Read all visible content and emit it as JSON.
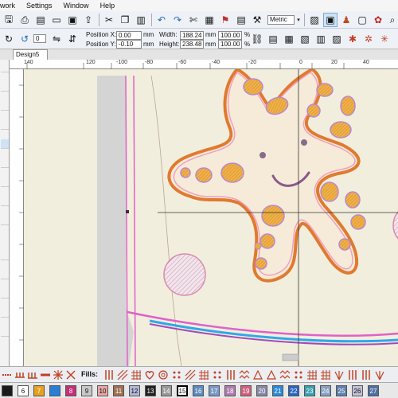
{
  "menu": [
    "work",
    "Settings",
    "Window",
    "Help"
  ],
  "toolbar": {
    "unit": "Metric",
    "position_x_label": "Position X:",
    "position_y_label": "Position Y:",
    "position_x": "0.00",
    "position_y": "-0.10",
    "width_label": "Width:",
    "height_label": "Height:",
    "width": "188.24",
    "height": "238.48",
    "unit_mm": "mm",
    "scale_w": "100.00",
    "scale_h": "100.00",
    "pct": "%",
    "rotate_value": "0"
  },
  "tabs": [
    {
      "label": "Design5",
      "close": "×"
    }
  ],
  "ruler_h": [
    "140",
    "120",
    "-100",
    "-80",
    "-60",
    "-40",
    "-20",
    "0",
    "20",
    "40"
  ],
  "fills_label": "Fills:",
  "colors": [
    {
      "hex": "#1a1a1a",
      "label": ""
    },
    {
      "hex": "#ffffff",
      "label": "6"
    },
    {
      "hex": "#e8a020",
      "label": "7"
    },
    {
      "hex": "#2a7fd4",
      "label": ""
    },
    {
      "hex": "#c4307a",
      "label": "8"
    },
    {
      "hex": "#c8c8c8",
      "label": "9"
    },
    {
      "hex": "#e8a6a6",
      "label": "10"
    },
    {
      "hex": "#a07050",
      "label": "11"
    },
    {
      "hex": "#b0b8d8",
      "label": "12"
    },
    {
      "hex": "#222222",
      "label": "13"
    },
    {
      "hex": "#999999",
      "label": "14"
    },
    {
      "hex": "#ffffff",
      "label": "15"
    },
    {
      "hex": "#5a8cc0",
      "label": "16"
    },
    {
      "hex": "#7a98c8",
      "label": "17"
    },
    {
      "hex": "#b07ab0",
      "label": "18"
    },
    {
      "hex": "#d06080",
      "label": "19"
    },
    {
      "hex": "#8888aa",
      "label": "20"
    },
    {
      "hex": "#2a8ad8",
      "label": "21"
    },
    {
      "hex": "#2a66c0",
      "label": "22"
    },
    {
      "hex": "#3aa0b0",
      "label": "23"
    },
    {
      "hex": "#88a0c0",
      "label": "24"
    },
    {
      "hex": "#6080b0",
      "label": "25"
    },
    {
      "hex": "#c0c0d8",
      "label": "26"
    },
    {
      "hex": "#5070a0",
      "label": "27"
    }
  ]
}
